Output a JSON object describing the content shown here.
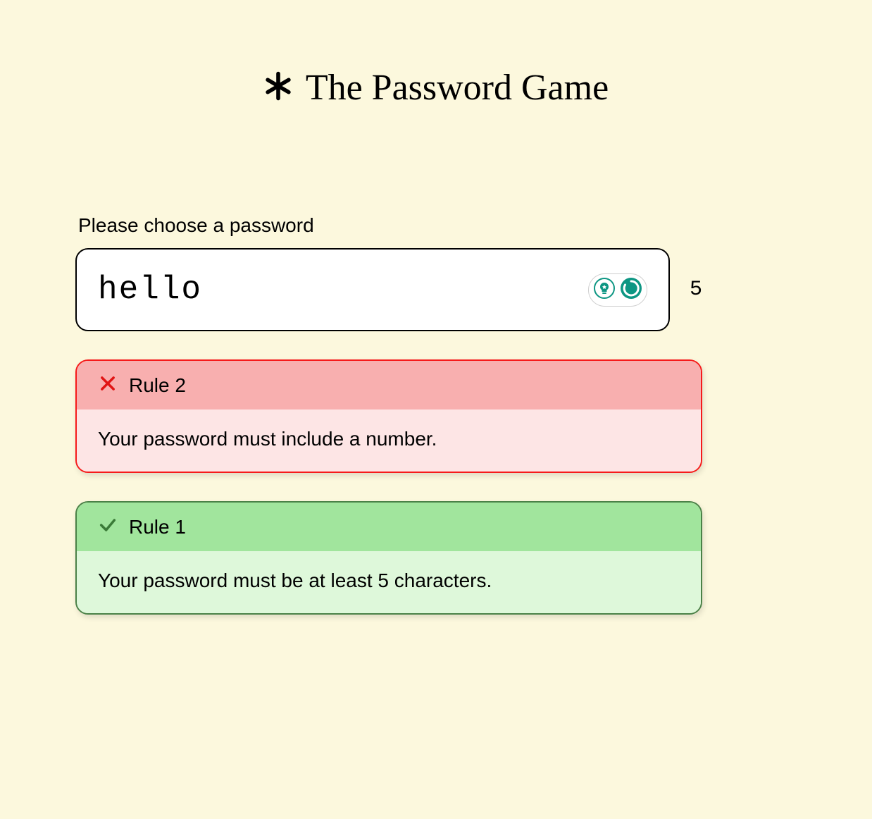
{
  "header": {
    "title": "The Password Game"
  },
  "prompt": {
    "label": "Please choose a password"
  },
  "password": {
    "value": "hello",
    "char_count": "5"
  },
  "rules": [
    {
      "status": "fail",
      "title": "Rule 2",
      "text": "Your password must include a number."
    },
    {
      "status": "pass",
      "title": "Rule 1",
      "text": "Your password must be at least 5 characters."
    }
  ],
  "colors": {
    "background": "#fcf8dd",
    "fail_border": "#f61a1a",
    "fail_header": "#f8afaf",
    "fail_body": "#fde5e5",
    "pass_border": "#4a8147",
    "pass_header": "#a1e59d",
    "pass_body": "#def8da",
    "teal_accent": "#0d9683"
  },
  "icons": {
    "title_icon": "asterisk-icon",
    "fail_icon": "x-icon",
    "pass_icon": "check-icon",
    "badge_left": "lightbulb-sparkle-icon",
    "badge_right": "spinner-icon"
  }
}
